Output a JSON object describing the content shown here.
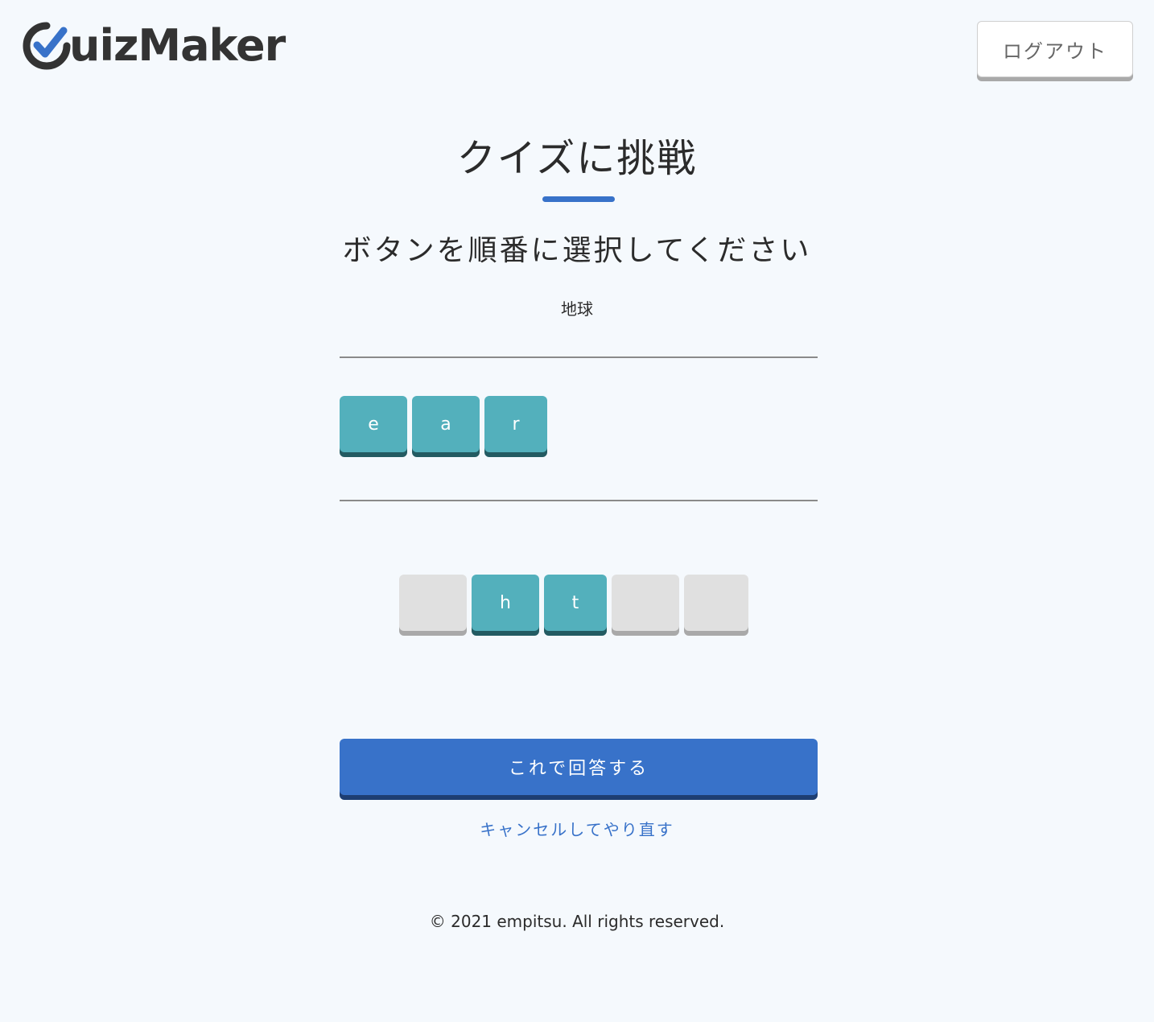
{
  "header": {
    "logo_text": "uizMaker",
    "logo_icon": "check-circle-icon",
    "logout_label": "ログアウト"
  },
  "main": {
    "title": "クイズに挑戦",
    "instruction": "ボタンを順番に選択してください",
    "hint": "地球",
    "answer_tiles": [
      {
        "letter": "e",
        "state": "filled"
      },
      {
        "letter": "a",
        "state": "filled"
      },
      {
        "letter": "r",
        "state": "filled"
      }
    ],
    "choice_tiles": [
      {
        "letter": "",
        "state": "used"
      },
      {
        "letter": "h",
        "state": "available"
      },
      {
        "letter": "t",
        "state": "available"
      },
      {
        "letter": "",
        "state": "used"
      },
      {
        "letter": "",
        "state": "used"
      }
    ],
    "submit_label": "これで回答する",
    "cancel_label": "キャンセルしてやり直す"
  },
  "footer": {
    "copyright": "© 2021 empitsu. All rights reserved."
  },
  "colors": {
    "background": "#f5f9fd",
    "accent": "#3872c9",
    "tile_filled": "#53b0bc",
    "tile_empty": "#e0e0e0"
  }
}
